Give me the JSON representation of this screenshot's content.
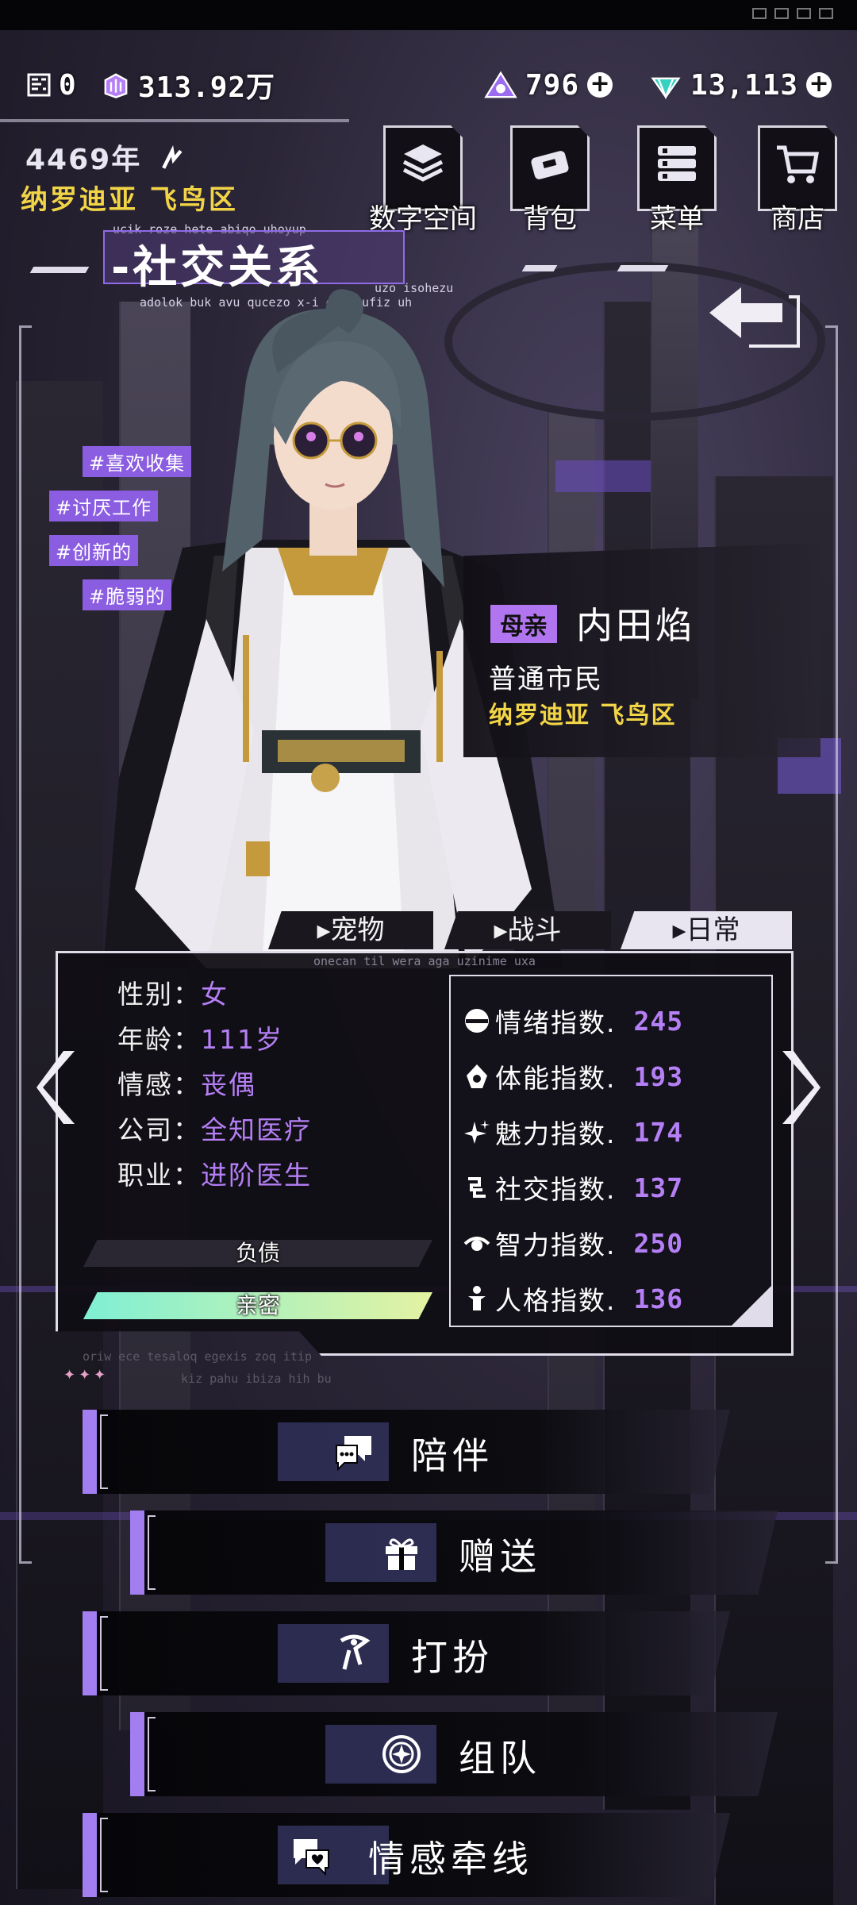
{
  "resources": {
    "chips": "0",
    "currency": "313.92万",
    "energy": "796",
    "gems": "13,113"
  },
  "world": {
    "year": "4469年",
    "location": "纳罗迪亚 飞鸟区"
  },
  "nav": {
    "digital_space": "数字空间",
    "backpack": "背包",
    "menu": "菜单",
    "shop": "商店"
  },
  "page": {
    "title": "-社交关系",
    "deco_top": "ucik roze hete abiqo uhoyup",
    "deco_bottom": "adolok buk avu qucezo x-i geh jufiz uh",
    "deco_side": "uzo isohezu"
  },
  "tags": [
    "#喜欢收集",
    "#讨厌工作",
    "#创新的",
    "#脆弱的"
  ],
  "character": {
    "relation": "母亲",
    "name": "内田焰",
    "role": "普通市民",
    "location": "纳罗迪亚 飞鸟区"
  },
  "tabs": {
    "pet": "宠物",
    "battle": "战斗",
    "daily": "日常",
    "active": "daily",
    "caption": "onecan til wera aga uzinime uxa"
  },
  "info": [
    {
      "key": "性别：",
      "value": "女"
    },
    {
      "key": "年龄：",
      "value": "111岁"
    },
    {
      "key": "情感：",
      "value": "丧偶"
    },
    {
      "key": "公司：",
      "value": "全知医疗"
    },
    {
      "key": "职业：",
      "value": "进阶医生"
    }
  ],
  "bars": {
    "debt_label": "负债",
    "debt_fill": 0,
    "intimacy_label": "亲密",
    "intimacy_fill": 1.0
  },
  "stats": [
    {
      "label": "情绪指数.",
      "value": "245",
      "icon": "mood-icon"
    },
    {
      "label": "体能指数.",
      "value": "193",
      "icon": "stamina-icon"
    },
    {
      "label": "魅力指数.",
      "value": "174",
      "icon": "charm-icon"
    },
    {
      "label": "社交指数.",
      "value": "137",
      "icon": "social-icon"
    },
    {
      "label": "智力指数.",
      "value": "250",
      "icon": "intellect-icon"
    },
    {
      "label": "人格指数.",
      "value": "136",
      "icon": "personality-icon"
    }
  ],
  "panel_foot": {
    "line1": "oriw ece tesaloq egexis zoq itip",
    "line2": "kiz pahu ibiza hih bu"
  },
  "actions": {
    "accompany": "陪伴",
    "gift": "赠送",
    "dress": "打扮",
    "team": "组队",
    "bond": "情感牵线"
  },
  "colors": {
    "accent": "#b57ff5",
    "gold": "#f2d546",
    "stripe": "#a27ef0"
  }
}
